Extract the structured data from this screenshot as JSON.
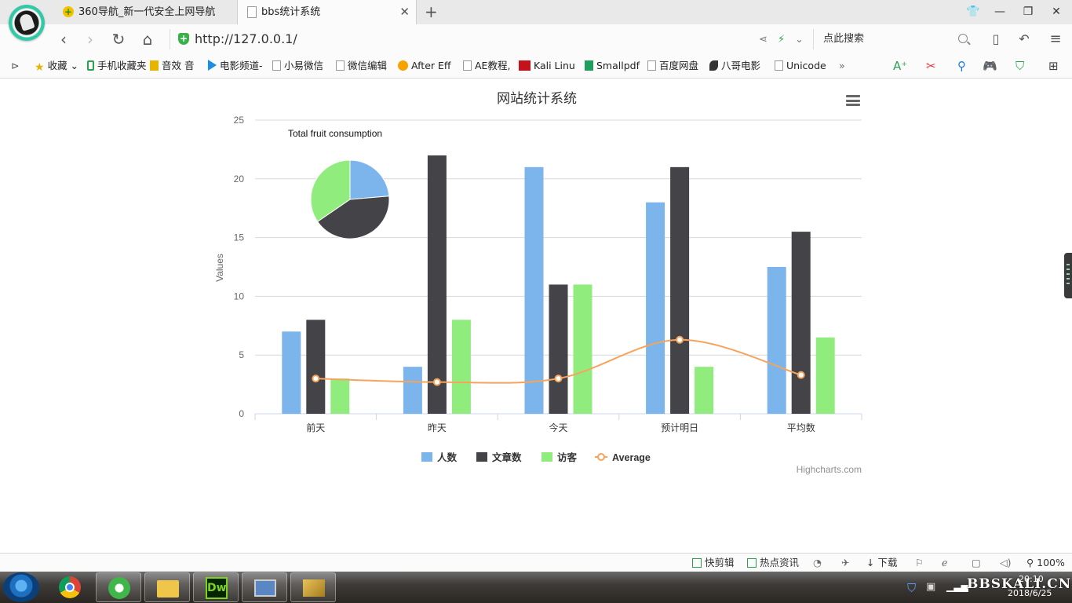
{
  "browser": {
    "tabs": [
      {
        "title": "360导航_新一代安全上网导航",
        "active": false
      },
      {
        "title": "bbs统计系统",
        "active": true
      }
    ],
    "new_tab_glyph": "+",
    "address": "http://127.0.0.1/",
    "search_placeholder": "点此搜索",
    "bookmarks": [
      {
        "label": "收藏",
        "icon": "star-icon"
      },
      {
        "label": "手机收藏夹",
        "icon": "phone-icon"
      },
      {
        "label": "音效 音",
        "icon": "square-icon"
      },
      {
        "label": "电影频道-",
        "icon": "play-icon"
      },
      {
        "label": "小易微信",
        "icon": "page-icon"
      },
      {
        "label": "微信编辑",
        "icon": "page-icon"
      },
      {
        "label": "After Eff",
        "icon": "ae-icon"
      },
      {
        "label": "AE教程,",
        "icon": "page-icon"
      },
      {
        "label": "Kali Linu",
        "icon": "kali-icon"
      },
      {
        "label": "Smallpdf",
        "icon": "pdf-icon"
      },
      {
        "label": "百度网盘",
        "icon": "page-icon"
      },
      {
        "label": "八哥电影",
        "icon": "bird-icon"
      },
      {
        "label": "Unicode",
        "icon": "page-icon"
      }
    ],
    "bookmark_more": "»",
    "status_items": [
      "快剪辑",
      "热点资讯",
      "下载"
    ],
    "zoom": "100%"
  },
  "chart": {
    "credits": "Highcharts.com",
    "pie_label": "Total fruit consumption",
    "colors": {
      "people": "#7cb5ec",
      "articles": "#434348",
      "visitors": "#90ed7d",
      "average": "#f7a35c"
    }
  },
  "chart_data": {
    "type": "bar",
    "title": "网站统计系统",
    "ylabel": "Values",
    "xlabel": "",
    "ylim": [
      0,
      25
    ],
    "yticks": [
      0,
      5,
      10,
      15,
      20,
      25
    ],
    "grid": true,
    "legend_position": "bottom",
    "categories": [
      "前天",
      "昨天",
      "今天",
      "预计明日",
      "平均数"
    ],
    "series": [
      {
        "name": "人数",
        "type": "column",
        "values": [
          7,
          4,
          21,
          18,
          12.5
        ]
      },
      {
        "name": "文章数",
        "type": "column",
        "values": [
          8,
          22,
          11,
          21,
          15.5
        ]
      },
      {
        "name": "访客",
        "type": "column",
        "values": [
          3,
          8,
          11,
          4,
          6.5
        ]
      },
      {
        "name": "Average",
        "type": "spline",
        "values": [
          3,
          2.7,
          3,
          6.3,
          3.3
        ]
      }
    ],
    "pie": {
      "title": "Total fruit consumption",
      "slices": [
        {
          "series": "人数",
          "value": 13
        },
        {
          "series": "文章数",
          "value": 23
        },
        {
          "series": "访客",
          "value": 19
        }
      ]
    }
  },
  "taskbar": {
    "clock_time": "20:10",
    "clock_date": "2018/6/25",
    "watermark": "BBSKALI.CN"
  }
}
